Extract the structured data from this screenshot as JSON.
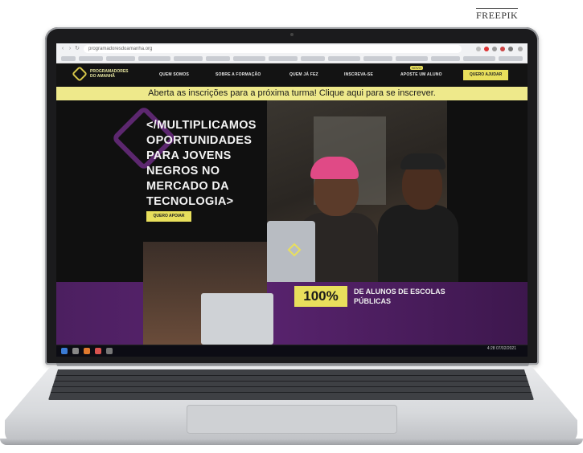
{
  "credit": "FREEPIK",
  "browser": {
    "url": "programadoresdoamanha.org"
  },
  "site": {
    "logo_text": "PROGRAMADORES DO AMANHÃ",
    "nav": {
      "items": [
        "QUEM SOMOS",
        "SOBRE A FORMAÇÃO",
        "QUEM JÁ FEZ",
        "INSCREVA-SE",
        "APOSTE UM ALUNO"
      ],
      "badge": "NOVO",
      "cta": "QUERO AJUDAR"
    },
    "banner": "Aberta as inscrições para a próxima turma! Clique aqui para se inscrever.",
    "hero": {
      "title": "</MULTIPLICAMOS OPORTUNIDADES PARA JOVENS NEGROS NO MERCADO DA TECNOLOGIA>",
      "button": "QUERO APOIAR",
      "stat_value": "100%",
      "stat_label": "DE ALUNOS DE ESCOLAS PÚBLICAS"
    }
  },
  "taskbar": {
    "clock": "4:28 07/02/2021"
  },
  "colors": {
    "accent": "#e8df5c",
    "purple": "#5a2470",
    "dark": "#131313"
  }
}
